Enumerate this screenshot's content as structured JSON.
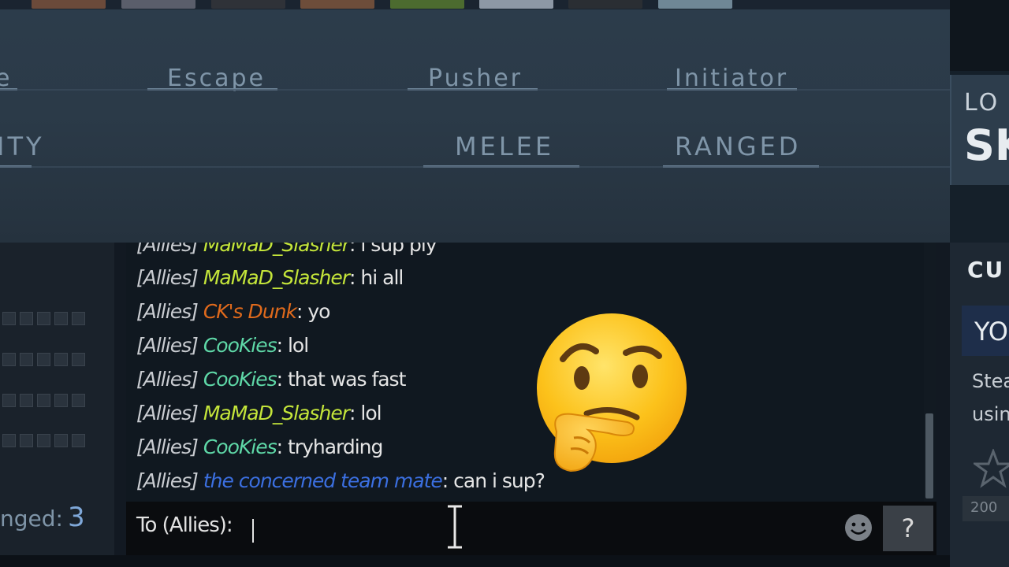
{
  "filters": {
    "roles": [
      "e",
      "Escape",
      "Pusher",
      "Initiator"
    ],
    "attack": [
      "ITY",
      "MELEE",
      "RANGED"
    ]
  },
  "right_panel": {
    "card_line1": "LO",
    "card_line2": "SK",
    "section_heading": "CU",
    "blue_button_text": "YO",
    "desc_line1": "Stea",
    "desc_line2": "usin",
    "price": "200"
  },
  "stats": {
    "ranged_label": "nged:",
    "ranged_count": "3"
  },
  "chat": {
    "channel": "[Allies]",
    "messages": [
      {
        "sender": "MaMaD_Slasher",
        "sender_color": "#c4e53a",
        "text": "i sup ply"
      },
      {
        "sender": "MaMaD_Slasher",
        "sender_color": "#c4e53a",
        "text": "hi all"
      },
      {
        "sender": "CK's Dunk",
        "sender_color": "#e06a1c",
        "text": "yo"
      },
      {
        "sender": "CooKies",
        "sender_color": "#5fd9a8",
        "text": "lol"
      },
      {
        "sender": "CooKies",
        "sender_color": "#5fd9a8",
        "text": "that was fast"
      },
      {
        "sender": "MaMaD_Slasher",
        "sender_color": "#c4e53a",
        "text": "lol"
      },
      {
        "sender": "CooKies",
        "sender_color": "#5fd9a8",
        "text": "tryharding"
      },
      {
        "sender": "the concerned team mate",
        "sender_color": "#3b6fe0",
        "text": "can i sup?"
      }
    ],
    "input_label": "To (Allies):",
    "input_value": "",
    "help_label": "?",
    "emoji_icon": "smiley-icon"
  },
  "overlay": {
    "emoji": "thinking-face-emoji"
  }
}
